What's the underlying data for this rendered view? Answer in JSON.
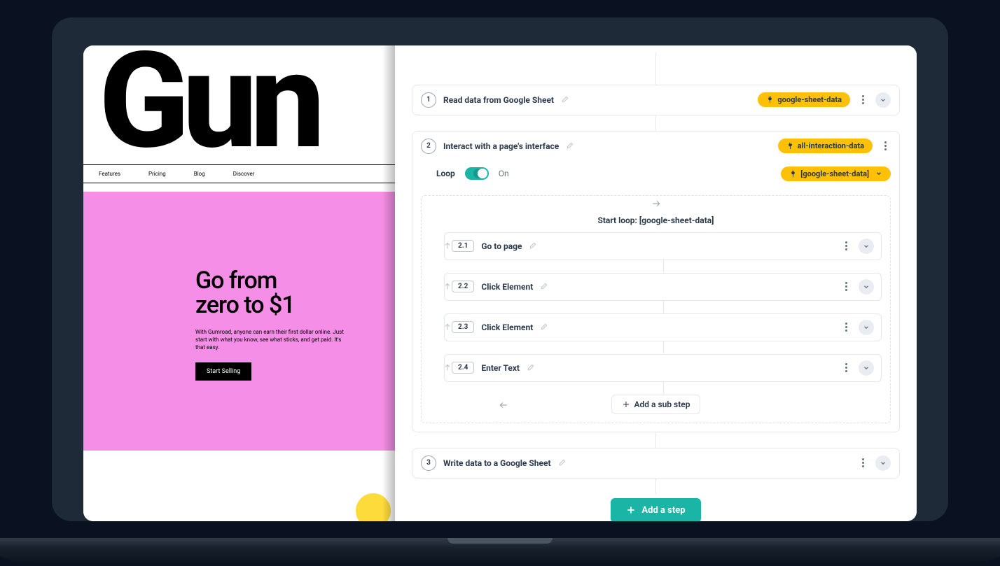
{
  "preview": {
    "logo_text": "Gun",
    "nav": [
      "Features",
      "Pricing",
      "Blog",
      "Discover"
    ],
    "hero_heading_l1": "Go from",
    "hero_heading_l2": "zero to $1",
    "hero_paragraph": "With Gumroad, anyone can earn their first dollar online. Just start with what you know, see what sticks, and get paid. It's that easy.",
    "hero_button": "Start Selling"
  },
  "workflow": {
    "steps": [
      {
        "num": "1",
        "title": "Read data from Google Sheet",
        "pill": "google-sheet-data"
      },
      {
        "num": "2",
        "title": "Interact with a page's interface",
        "pill": "all-interaction-data",
        "loop": {
          "label": "Loop",
          "state": "On",
          "source_pill": "[google-sheet-data]",
          "start_label": "Start loop: [google-sheet-data]",
          "substeps": [
            {
              "num": "2.1",
              "title": "Go to page"
            },
            {
              "num": "2.2",
              "title": "Click Element"
            },
            {
              "num": "2.3",
              "title": "Click Element"
            },
            {
              "num": "2.4",
              "title": "Enter Text"
            }
          ],
          "add_sub_label": "Add a sub step"
        }
      },
      {
        "num": "3",
        "title": "Write data to a Google Sheet"
      }
    ],
    "add_step_label": "Add a step"
  }
}
